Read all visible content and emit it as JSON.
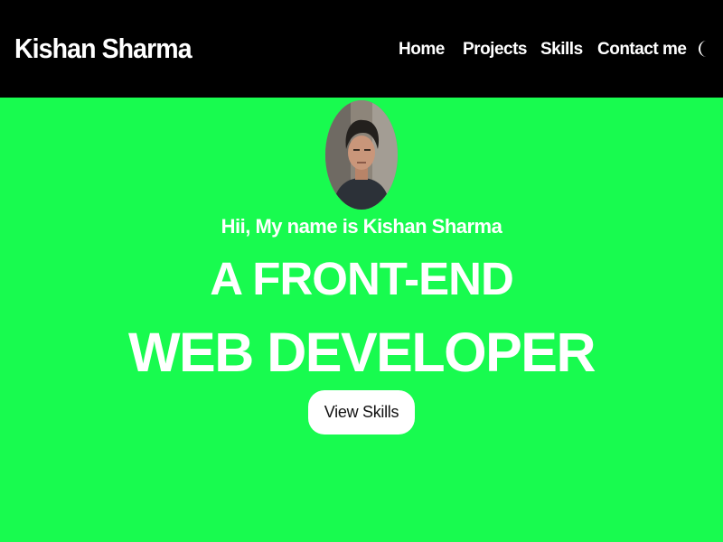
{
  "navbar": {
    "brand": "Kishan Sharma",
    "links": [
      "Home",
      "Projects",
      "Skills",
      "Contact me"
    ],
    "theme_icon": "crescent-moon-icon"
  },
  "hero": {
    "avatar_icon": "profile-photo",
    "greeting": "Hii, My name is Kishan Sharma",
    "headline_line1": "A FRONT-END",
    "headline_line2": "WEB DEVELOPER",
    "cta_label": "View Skills"
  },
  "colors": {
    "background": "#18fb4f",
    "navbar": "#000000",
    "text": "#ffffff",
    "button_bg": "#ffffff",
    "button_text": "#111111"
  }
}
